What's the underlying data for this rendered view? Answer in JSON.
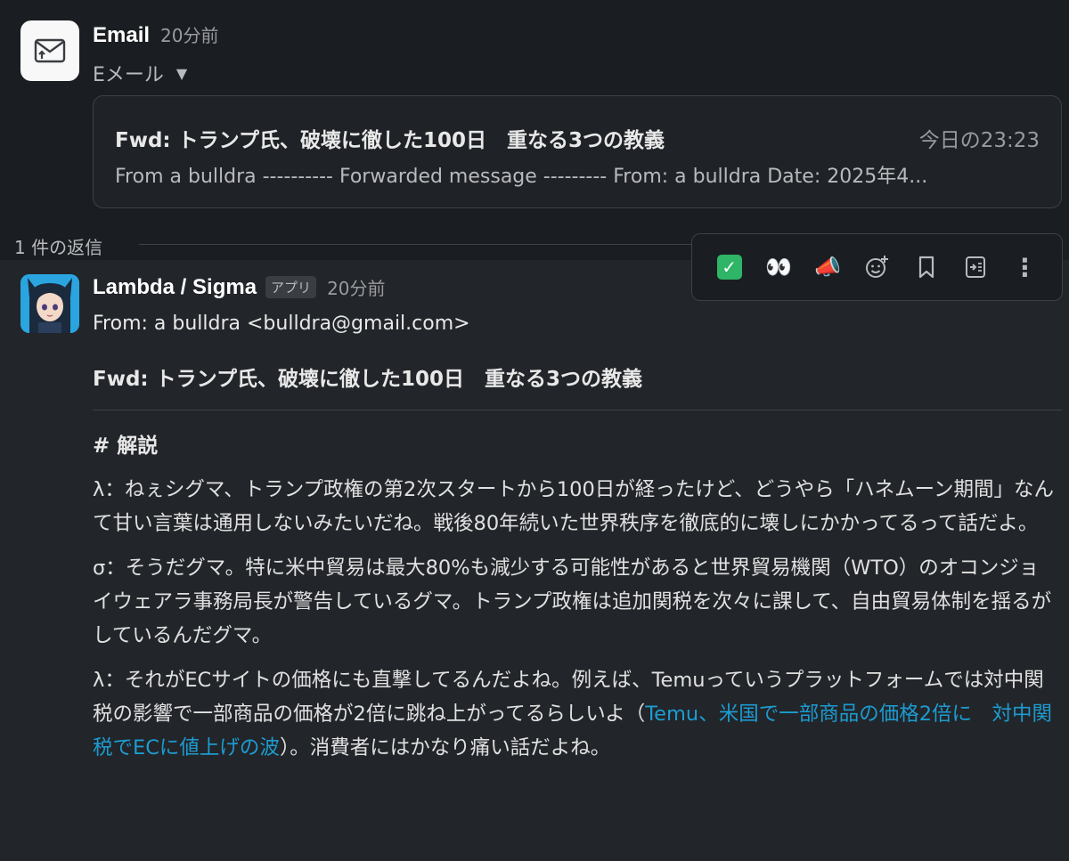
{
  "top_message": {
    "sender": "Email",
    "time": "20分前",
    "subtitle": "Eメール",
    "card": {
      "subject": "Fwd: トランプ氏、破壊に徹した100日　重なる3つの教義",
      "time": "今日の23:23",
      "preview": "From a bulldra  ---------- Forwarded message --------- From: a bulldra Date: 2025年4..."
    }
  },
  "thread": {
    "reply_count": "1 件の返信"
  },
  "toolbar": {
    "icons": [
      "check-mark-icon",
      "eyes-icon",
      "megaphone-icon",
      "add-reaction-icon",
      "bookmark-icon",
      "forward-icon",
      "more-icon"
    ],
    "eyes": "👀",
    "megaphone": "📣",
    "more": "⋮"
  },
  "reply": {
    "name": "Lambda / Sigma",
    "badge": "アプリ",
    "time": "20分前",
    "from": "From: a bulldra <bulldra@gmail.com>",
    "subject": "Fwd: トランプ氏、破壊に徹した100日　重なる3つの教義",
    "heading": "# 解説",
    "p1": "λ：ねぇシグマ、トランプ政権の第2次スタートから100日が経ったけど、どうやら「ハネムーン期間」なんて甘い言葉は通用しないみたいだね。戦後80年続いた世界秩序を徹底的に壊しにかかってるって話だよ。",
    "p2": "σ：そうだグマ。特に米中貿易は最大80%も減少する可能性があると世界貿易機関（WTO）のオコンジョイウェアラ事務局長が警告しているグマ。トランプ政権は追加関税を次々に課して、自由貿易体制を揺るがしているんだグマ。",
    "p3_before": "λ：それがECサイトの価格にも直撃してるんだよね。例えば、Temuっていうプラットフォームでは対中関税の影響で一部商品の価格が2倍に跳ね上がってるらしいよ（",
    "p3_link": "Temu、米国で一部商品の価格2倍に　対中関税でECに値上げの波",
    "p3_after": "）。消費者にはかなり痛い話だよね。"
  },
  "colors": {
    "background": "#1a1d21",
    "reply_background": "#222529",
    "link": "#1d9bd1",
    "check": "#2eb567"
  }
}
